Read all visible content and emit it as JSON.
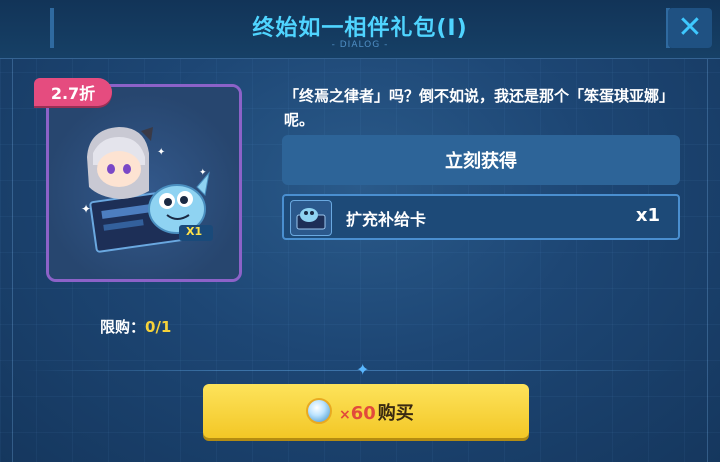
{
  "header": {
    "title": "终始如一相伴礼包(Ⅰ)",
    "subtitle": "DIALOG",
    "close_icon": "close-icon"
  },
  "item": {
    "discount": "2.7折",
    "quantity_badge": "X1",
    "limit_label": "限购：",
    "limit_value": "0/1"
  },
  "description": "「终焉之律者」吗？倒不如说，我还是那个「笨蛋琪亚娜」呢。",
  "claim_button": "立刻获得",
  "reward": {
    "name": "扩充补给卡",
    "quantity": "x1"
  },
  "purchase": {
    "multiplier": "×",
    "price": "60",
    "label": "购买",
    "currency_icon": "crystal-coin-icon"
  },
  "colors": {
    "title": "#4fd4ff",
    "discount": "#e54c7f",
    "frame": "#8c62c8",
    "buy_button": "#f7d33a",
    "price": "#e24a3b",
    "limit_value": "#f5d23a"
  }
}
